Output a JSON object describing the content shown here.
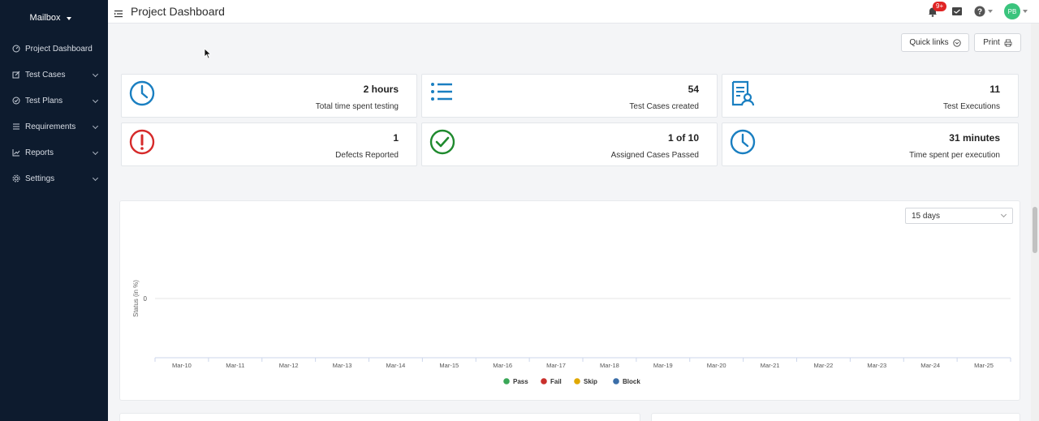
{
  "sidebar": {
    "brand": "Mailbox",
    "items": [
      {
        "label": "Project Dashboard",
        "icon": "dashboard-icon",
        "expandable": false
      },
      {
        "label": "Test Cases",
        "icon": "edit-icon",
        "expandable": true
      },
      {
        "label": "Test Plans",
        "icon": "check-circle-icon",
        "expandable": true
      },
      {
        "label": "Requirements",
        "icon": "list-icon",
        "expandable": true
      },
      {
        "label": "Reports",
        "icon": "chart-icon",
        "expandable": true
      },
      {
        "label": "Settings",
        "icon": "gear-icon",
        "expandable": true
      }
    ]
  },
  "header": {
    "title": "Project Dashboard",
    "notification_badge": "9+",
    "avatar_initials": "PB"
  },
  "toolbar": {
    "quick_links": "Quick links",
    "print": "Print"
  },
  "stats": [
    {
      "value": "2 hours",
      "label": "Total time spent testing",
      "icon": "clock-icon",
      "color": "#1a7fc1"
    },
    {
      "value": "54",
      "label": "Test Cases created",
      "icon": "list-icon",
      "color": "#1a7fc1"
    },
    {
      "value": "11",
      "label": "Test Executions",
      "icon": "document-user-icon",
      "color": "#1a7fc1"
    },
    {
      "value": "1",
      "label": "Defects Reported",
      "icon": "alert-icon",
      "color": "#d62a2a"
    },
    {
      "value": "1 of 10",
      "label": "Assigned Cases Passed",
      "icon": "check-circle-icon",
      "color": "#1f8a2e"
    },
    {
      "value": "31 minutes",
      "label": "Time spent per execution",
      "icon": "clock-icon",
      "color": "#1a7fc1"
    }
  ],
  "chart_panel": {
    "range_select": "15 days"
  },
  "chart_data": {
    "type": "line",
    "title": "",
    "xlabel": "",
    "ylabel": "Status (in %)",
    "categories": [
      "Mar-10",
      "Mar-11",
      "Mar-12",
      "Mar-13",
      "Mar-14",
      "Mar-15",
      "Mar-16",
      "Mar-17",
      "Mar-18",
      "Mar-19",
      "Mar-20",
      "Mar-21",
      "Mar-22",
      "Mar-23",
      "Mar-24",
      "Mar-25"
    ],
    "yticks": [
      "0"
    ],
    "series": [
      {
        "name": "Pass",
        "color": "#3aa757",
        "values": []
      },
      {
        "name": "Fail",
        "color": "#c9302c",
        "values": []
      },
      {
        "name": "Skip",
        "color": "#e0a800",
        "values": []
      },
      {
        "name": "Block",
        "color": "#3b6ea8",
        "values": []
      }
    ],
    "legend": "bottom",
    "grid": true
  }
}
